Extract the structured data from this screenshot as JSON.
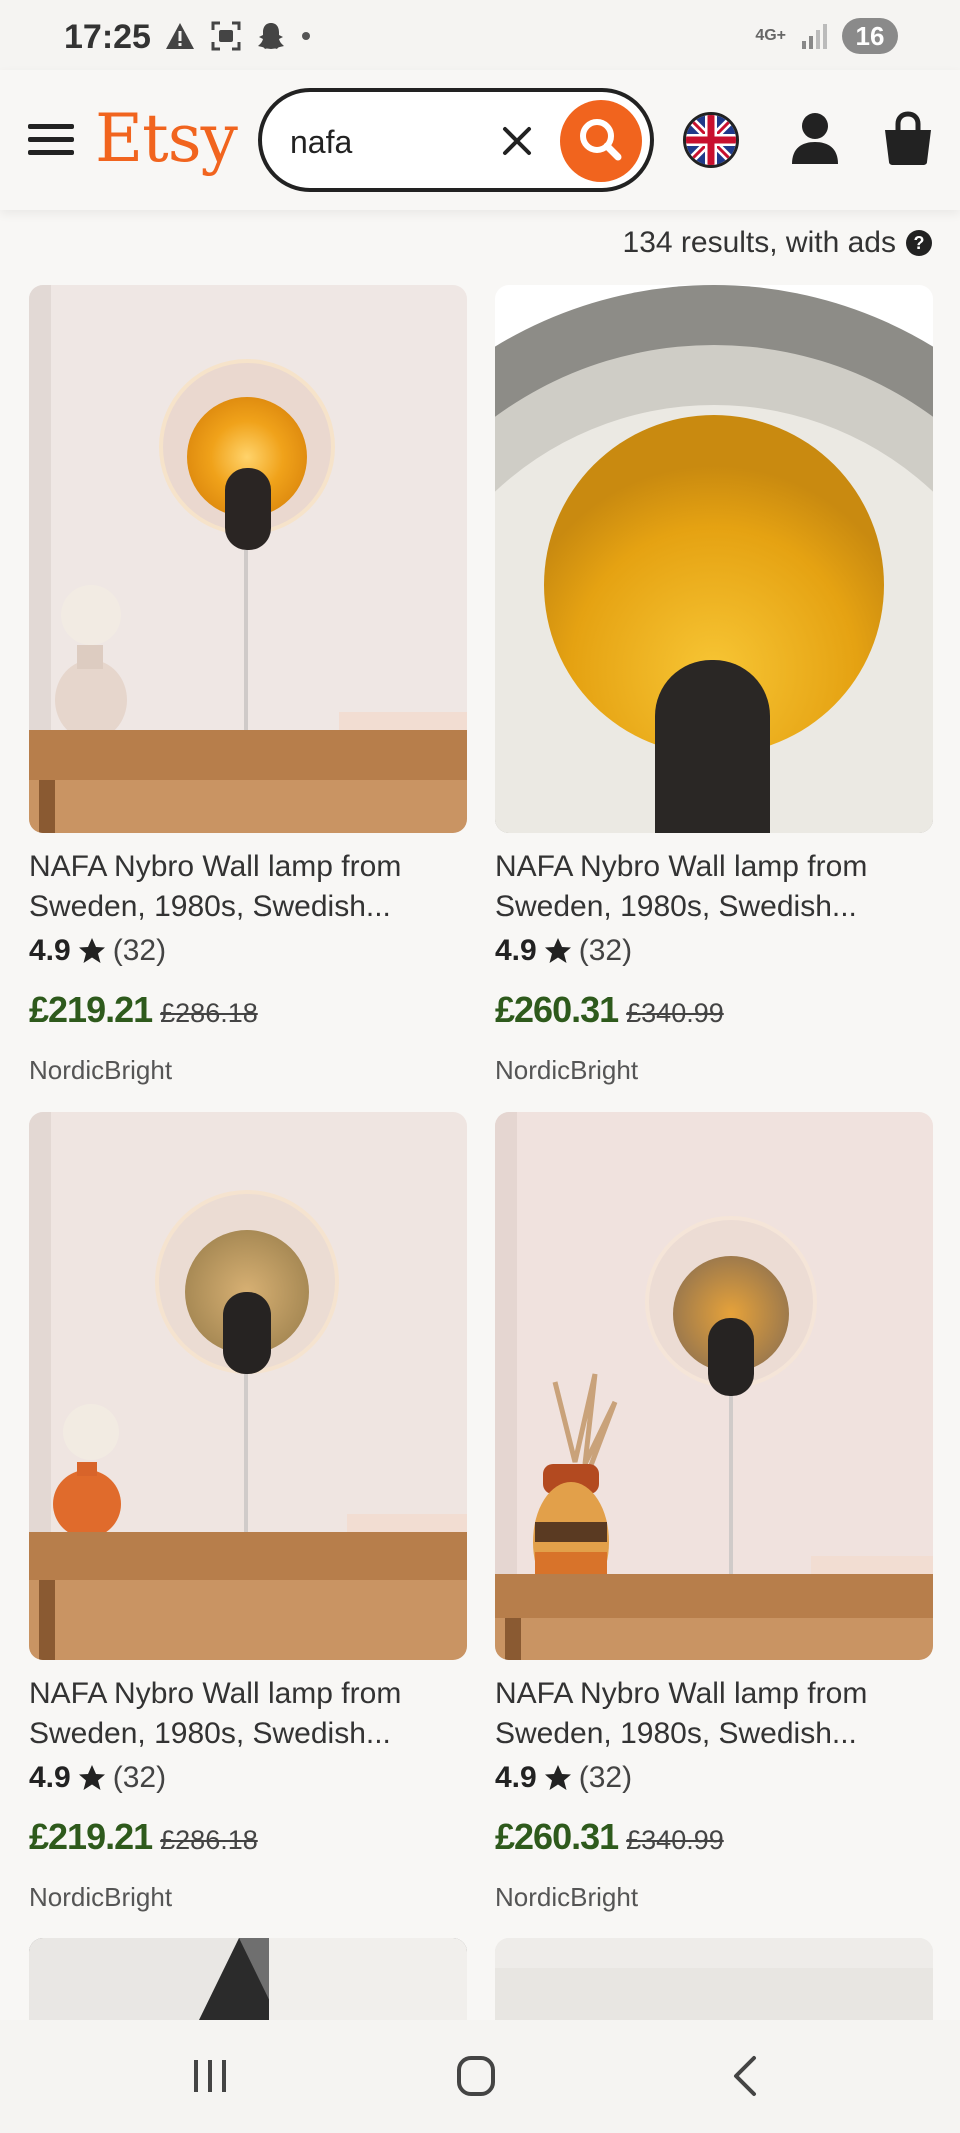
{
  "status_bar": {
    "time": "17:25",
    "network": "4G+",
    "battery": "16"
  },
  "header": {
    "logo": "Etsy",
    "search_value": "nafa",
    "brand_color": "#f1641e"
  },
  "results": {
    "summary": "134 results, with ads",
    "help_glyph": "?"
  },
  "listings": [
    {
      "title": "NAFA Nybro Wall lamp from Sweden, 1980s, Swedish...",
      "rating": "4.9",
      "reviews": "(32)",
      "price": "£219.21",
      "original_price": "£286.18",
      "shop": "NordicBright",
      "image": "wall-lamp-white-vase"
    },
    {
      "title": "NAFA Nybro Wall lamp from Sweden, 1980s, Swedish...",
      "rating": "4.9",
      "reviews": "(32)",
      "price": "£260.31",
      "original_price": "£340.99",
      "shop": "NordicBright",
      "image": "wall-lamp-closeup"
    },
    {
      "title": "NAFA Nybro Wall lamp from Sweden, 1980s, Swedish...",
      "rating": "4.9",
      "reviews": "(32)",
      "price": "£219.21",
      "original_price": "£286.18",
      "shop": "NordicBright",
      "image": "wall-lamp-orange-vase"
    },
    {
      "title": "NAFA Nybro Wall lamp from Sweden, 1980s, Swedish...",
      "rating": "4.9",
      "reviews": "(32)",
      "price": "£260.31",
      "original_price": "£340.99",
      "shop": "NordicBright",
      "image": "wall-lamp-striped-vase"
    }
  ]
}
